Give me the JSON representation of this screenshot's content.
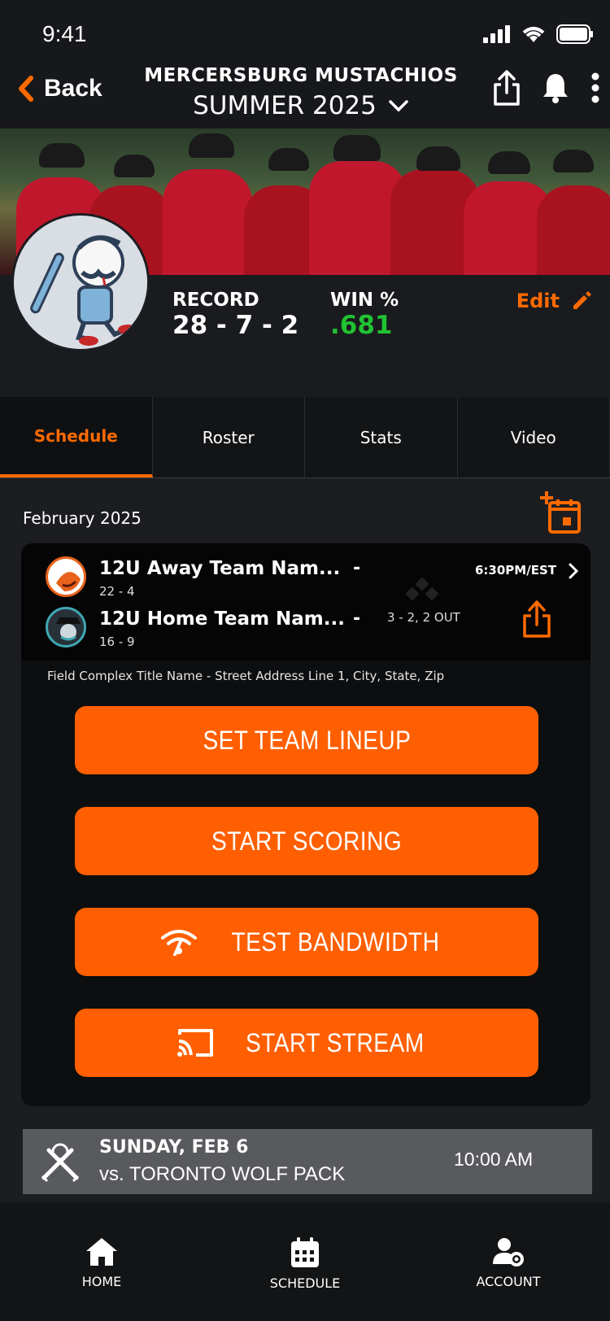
{
  "status": {
    "time": "9:41"
  },
  "nav": {
    "back_label": "Back",
    "team_name": "MERCERSBURG MUSTACHIOS",
    "season": "SUMMER 2025"
  },
  "team": {
    "record_label": "RECORD",
    "record_value": "28 - 7 - 2",
    "win_label": "WIN %",
    "win_value": ".681",
    "edit_label": "Edit",
    "win_color": "#21c233"
  },
  "tabs": [
    {
      "label": "Schedule",
      "active": true
    },
    {
      "label": "Roster",
      "active": false
    },
    {
      "label": "Stats",
      "active": false
    },
    {
      "label": "Video",
      "active": false
    }
  ],
  "schedule": {
    "month": "February 2025",
    "game": {
      "away_name": "12U Away Team Nam...",
      "away_record": "22 - 4",
      "away_score": "-",
      "home_name": "12U Home Team Nam...",
      "home_record": "16 - 9",
      "home_score": "-",
      "time": "6:30PM/EST",
      "count": "3 - 2, 2 OUT",
      "address": "Field Complex Title Name - Street Address Line 1, City, State, Zip"
    },
    "buttons": {
      "lineup": "SET TEAM LINEUP",
      "scoring": "START SCORING",
      "bandwidth": "TEST BANDWIDTH",
      "stream": "START STREAM"
    },
    "next": {
      "date": "SUNDAY, FEB 6",
      "opponent": "vs. TORONTO WOLF PACK",
      "time": "10:00 AM"
    }
  },
  "bottom_nav": {
    "home": "HOME",
    "schedule": "SCHEDULE",
    "account": "ACCOUNT"
  },
  "colors": {
    "accent": "#ff5f00",
    "background": "#1c1d20"
  }
}
